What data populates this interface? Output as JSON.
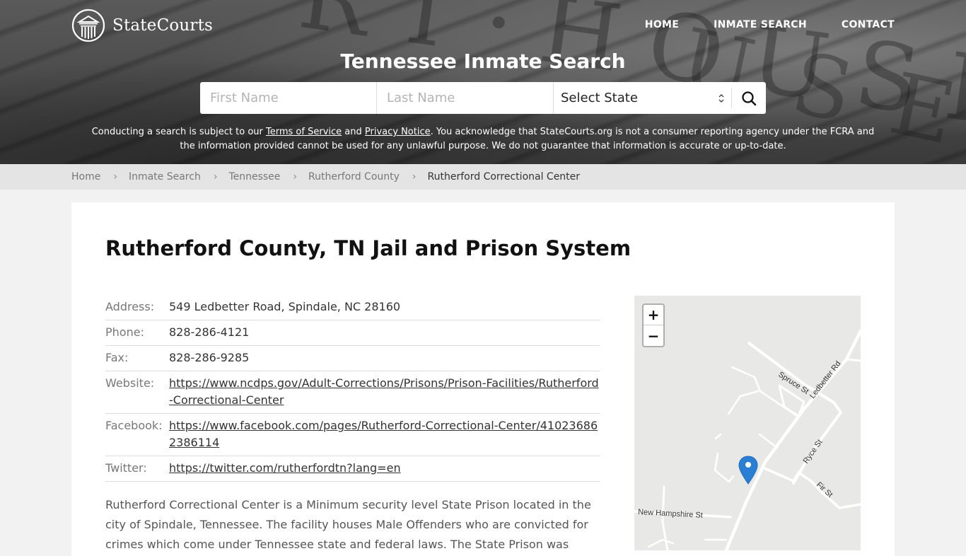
{
  "header": {
    "logo_text": "StateCourts",
    "nav": [
      {
        "label": "HOME"
      },
      {
        "label": "INMATE SEARCH"
      },
      {
        "label": "CONTACT"
      }
    ],
    "hero_title": "Tennessee Inmate Search",
    "search": {
      "first_name_placeholder": "First Name",
      "last_name_placeholder": "Last Name",
      "state_select_value": "Select State",
      "search_icon": "search-icon"
    },
    "disclaimer": {
      "part1": "Conducting a search is subject to our ",
      "terms_link": "Terms of Service",
      "part2": " and ",
      "privacy_link": "Privacy Notice",
      "part3": ". You acknowledge that StateCourts.org is not a consumer reporting agency under the FCRA and the information provided cannot be used for any unlawful purpose. We do not guarantee that information is accurate or up-to-date."
    }
  },
  "breadcrumb": [
    {
      "label": "Home"
    },
    {
      "label": "Inmate Search"
    },
    {
      "label": "Tennessee"
    },
    {
      "label": "Rutherford County"
    },
    {
      "label": "Rutherford Correctional Center"
    }
  ],
  "main": {
    "title": "Rutherford County, TN Jail and Prison System",
    "info": [
      {
        "label": "Address:",
        "value": "549 Ledbetter Road, Spindale, NC 28160"
      },
      {
        "label": "Phone:",
        "value": "828-286-4121"
      },
      {
        "label": "Fax:",
        "value": "828-286-9285"
      },
      {
        "label": "Website:",
        "value": "https://www.ncdps.gov/Adult-Corrections/Prisons/Prison-Facilities/Rutherford-Correctional-Center"
      },
      {
        "label": "Facebook:",
        "value": "https://www.facebook.com/pages/Rutherford-Correctional-Center/410236862386114"
      },
      {
        "label": "Twitter:",
        "value": "https://twitter.com/rutherfordtn?lang=en"
      }
    ],
    "description": "Rutherford Correctional Center is a Minimum security level State Prison located in the city of Spindale, Tennessee. The facility houses Male Offenders who are convicted for crimes which come under Tennessee state and federal laws. The State Prison was"
  },
  "map": {
    "zoom_in": "+",
    "zoom_out": "−",
    "street_labels": [
      "Spruce St",
      "Ledbetter Rd",
      "Ryce St",
      "Fir St",
      "New Hampshire St"
    ],
    "marker_color": "#2a7fd4"
  }
}
